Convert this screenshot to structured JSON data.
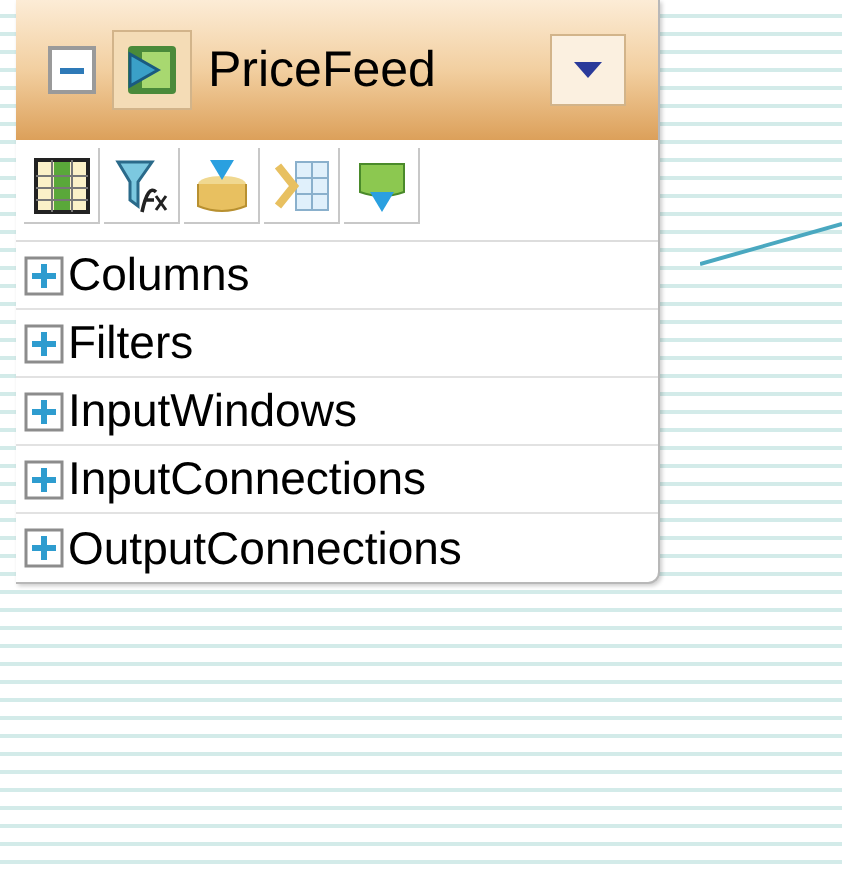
{
  "node": {
    "title": "PriceFeed",
    "collapsed": false,
    "sections": [
      {
        "label": "Columns",
        "expanded": false
      },
      {
        "label": "Filters",
        "expanded": false
      },
      {
        "label": "InputWindows",
        "expanded": false
      },
      {
        "label": "InputConnections",
        "expanded": false
      },
      {
        "label": "OutputConnections",
        "expanded": false
      }
    ]
  }
}
